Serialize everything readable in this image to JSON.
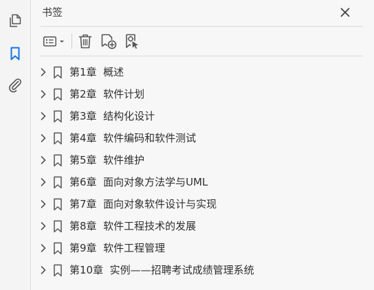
{
  "panel": {
    "title": "书签"
  },
  "rail": {
    "items": [
      {
        "icon": "pages-icon"
      },
      {
        "icon": "bookmark-icon",
        "active": true
      },
      {
        "icon": "attachment-icon"
      }
    ]
  },
  "toolbar": {
    "buttons": [
      "options-menu-icon",
      "delete-icon",
      "new-bookmark-icon",
      "new-bookmark-from-structure-icon"
    ]
  },
  "colors": {
    "accent": "#1473e6",
    "icon": "#555555",
    "text": "#2f2f2f",
    "background": "#f7f7f7"
  },
  "bookmarks": [
    {
      "label": "第1章  概述"
    },
    {
      "label": "第2章  软件计划"
    },
    {
      "label": "第3章  结构化设计"
    },
    {
      "label": "第4章  软件编码和软件测试"
    },
    {
      "label": "第5章  软件维护"
    },
    {
      "label": "第6章  面向对象方法学与UML"
    },
    {
      "label": "第7章  面向对象软件设计与实现"
    },
    {
      "label": "第8章  软件工程技术的发展"
    },
    {
      "label": "第9章  软件工程管理"
    },
    {
      "label": "第10章  实例——招聘考试成绩管理系统"
    }
  ]
}
